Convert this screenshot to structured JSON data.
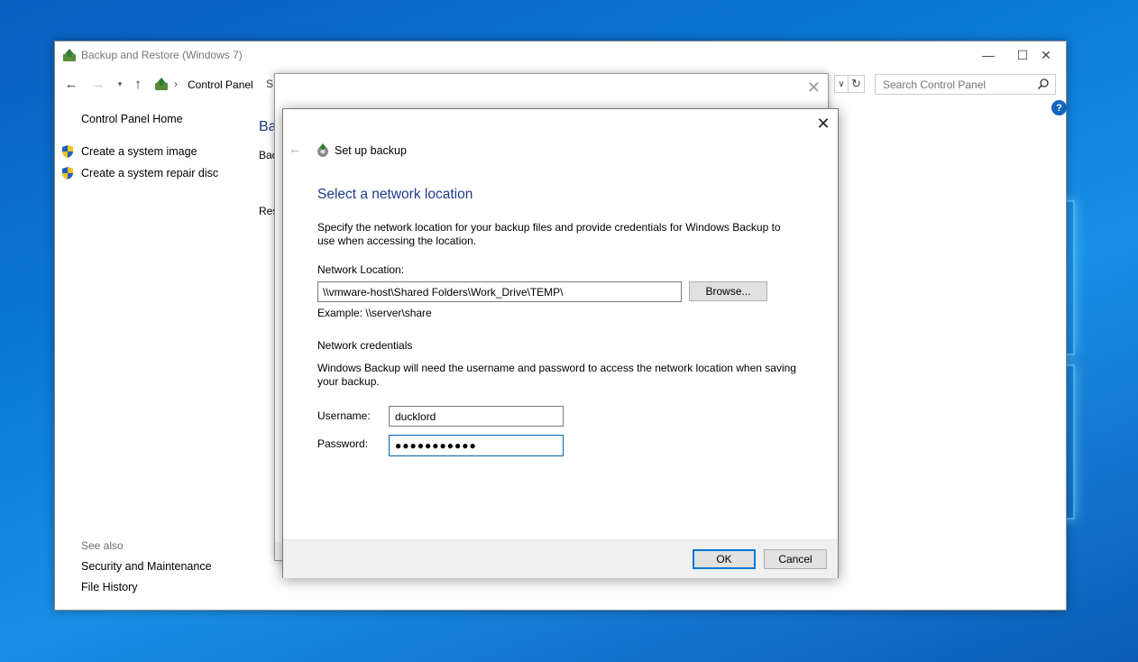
{
  "window": {
    "title": "Backup and Restore (Windows 7)",
    "min_glyph": "—",
    "max_glyph": "☐",
    "close_glyph": "✕"
  },
  "address": {
    "crumb": "Control Panel",
    "crumb_next": "S",
    "search_placeholder": "Search Control Panel"
  },
  "sidebar": {
    "home": "Control Panel Home",
    "links": [
      "Create a system image",
      "Create a system repair disc"
    ],
    "see_also_label": "See also",
    "see_also_links": [
      "Security and Maintenance",
      "File History"
    ]
  },
  "main": {
    "title_peek": "Bac",
    "line1_peek": "Bac",
    "line2_peek": "Rest"
  },
  "dialog": {
    "title": "Set up backup",
    "heading": "Select a network location",
    "description": "Specify the network location for your backup files and provide credentials for Windows Backup to use when accessing the location.",
    "network_location_label": "Network Location:",
    "network_location_value": "\\\\vmware-host\\Shared Folders\\Work_Drive\\TEMP\\",
    "browse_label": "Browse...",
    "example": "Example: \\\\server\\share",
    "credentials_label": "Network credentials",
    "credentials_desc": "Windows Backup will need the username and password to access the network location when saving your backup.",
    "username_label": "Username:",
    "username_value": "ducklord",
    "password_label": "Password:",
    "password_value": "●●●●●●●●●●●",
    "ok_label": "OK",
    "cancel_label": "Cancel"
  },
  "icons": {
    "back": "←",
    "forward": "→",
    "recent": "▾",
    "up": "↑",
    "crumb_sep": "›",
    "dropdown": "∨",
    "refresh": "↻",
    "help": "?",
    "close": "✕",
    "dialog_back": "←"
  },
  "colors": {
    "accent": "#0078d7",
    "heading": "#1e3a8a",
    "help": "#1565c0"
  }
}
